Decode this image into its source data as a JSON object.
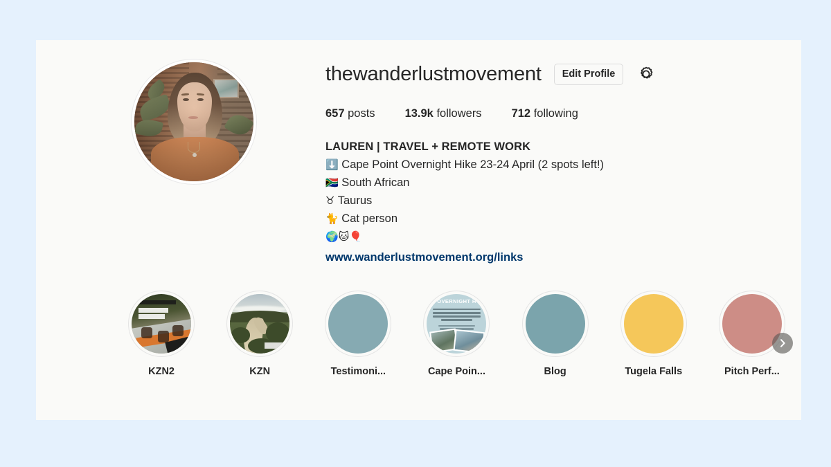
{
  "page": {
    "background_color": "#e5f1fd",
    "card_background": "#fafaf8"
  },
  "profile": {
    "username": "thewanderlustmovement",
    "avatar_alt": "profile-photo",
    "edit_profile_label": "Edit Profile",
    "settings_icon": "gear-icon",
    "stats": [
      {
        "value": "657",
        "label": "posts"
      },
      {
        "value": "13.9k",
        "label": "followers"
      },
      {
        "value": "712",
        "label": "following"
      }
    ],
    "bio": {
      "title": "LAUREN | TRAVEL + REMOTE WORK",
      "lines": [
        {
          "emoji": "⬇️",
          "text": "Cape Point Overnight Hike 23-24 April (2 spots left!)"
        },
        {
          "emoji": "🇿🇦",
          "text": "South African"
        },
        {
          "emoji": "♉",
          "text": "Taurus"
        },
        {
          "emoji": "🐈",
          "text": "Cat person"
        },
        {
          "emoji": "🌍🐱🎈",
          "text": ""
        }
      ],
      "link": "www.wanderlustmovement.org/links",
      "link_color": "#00376b"
    }
  },
  "highlights": {
    "next_button_icon": "chevron-right-icon",
    "items": [
      {
        "label": "KZN2",
        "thumb": "photo-dark-table",
        "color": "#4b5533"
      },
      {
        "label": "KZN",
        "thumb": "photo-path-landscape",
        "color": "#5c6b42"
      },
      {
        "label": "Testimoni...",
        "thumb": "solid",
        "color": "#86aab2"
      },
      {
        "label": "Cape Poin...",
        "thumb": "flyer-overnight-hike",
        "color": "#bcd4da",
        "flyer_title": "OVERNIGHT H"
      },
      {
        "label": "Blog",
        "thumb": "solid",
        "color": "#7ba4ac"
      },
      {
        "label": "Tugela Falls",
        "thumb": "solid",
        "color": "#f5c75a"
      },
      {
        "label": "Pitch Perf...",
        "thumb": "solid",
        "color": "#cd8d86"
      }
    ]
  }
}
